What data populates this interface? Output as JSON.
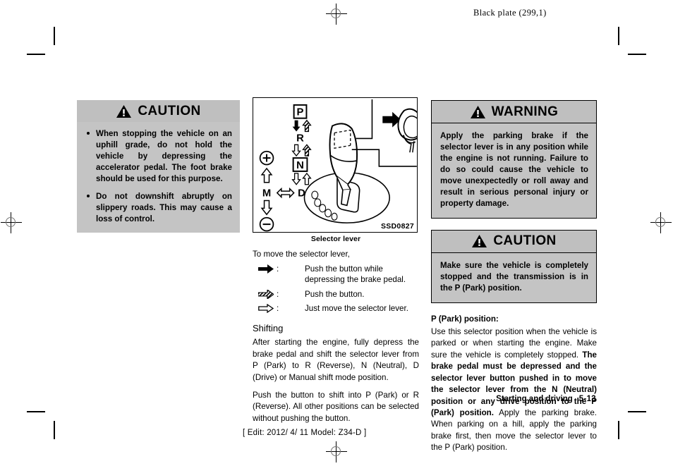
{
  "header": {
    "black_plate": "Black plate (299,1)"
  },
  "footer": {
    "section": "Starting and driving",
    "page": "5-13",
    "edit_line": "[ Edit: 2012/ 4/ 11   Model: Z34-D ]"
  },
  "left_column": {
    "caution": {
      "title": "CAUTION",
      "icon": "warning-triangle-icon",
      "bullets": [
        "When stopping the vehicle on an uphill grade, do not hold the vehicle by depressing the accelerator pedal. The foot brake should be used for this purpose.",
        "Do not downshift abruptly on slippery roads. This may cause a loss of control."
      ]
    }
  },
  "middle_column": {
    "figure": {
      "code": "SSD0827",
      "caption": "Selector lever",
      "gear_labels": {
        "park": "P",
        "reverse": "R",
        "neutral": "N",
        "drive": "D",
        "manual": "M",
        "upshift": "+",
        "downshift": "−"
      }
    },
    "intro": "To move the selector lever,",
    "legend": [
      {
        "icon": "solid-black-arrow-icon",
        "colon": ":",
        "text": "Push the button while depressing the brake pedal."
      },
      {
        "icon": "hatched-arrow-icon",
        "colon": ":",
        "text": "Push the button."
      },
      {
        "icon": "outline-arrow-icon",
        "colon": ":",
        "text": "Just move the selector lever."
      }
    ],
    "shifting": {
      "heading": "Shifting",
      "paragraphs": [
        "After starting the engine, fully depress the brake pedal and shift the selector lever from P (Park) to R (Reverse), N (Neutral), D (Drive) or Manual shift mode position.",
        "Push the button to shift into P (Park) or R (Reverse). All other positions can be selected without pushing the button."
      ]
    }
  },
  "right_column": {
    "warning": {
      "title": "WARNING",
      "icon": "warning-triangle-icon",
      "text": "Apply the parking brake if the selector lever is in any position while the engine is not running. Failure to do so could cause the vehicle to move unexpectedly or roll away and result in serious personal injury or property damage."
    },
    "caution": {
      "title": "CAUTION",
      "icon": "warning-triangle-icon",
      "text": "Make sure the vehicle is completely stopped and the transmission is in the P (Park) position."
    },
    "park_section": {
      "heading": "P (Park) position:",
      "text_part1": "Use this selector position when the vehicle is parked or when starting the engine. Make sure the vehicle is completely stopped. ",
      "text_bold": "The brake pedal must be depressed and the selector lever button pushed in to move the selector lever from the N (Neutral) position or any drive position to the P (Park) position.",
      "text_part2": " Apply the parking brake. When parking on a hill, apply the parking brake first, then move the selector lever to the P (Park) position."
    }
  },
  "colors": {
    "alert_header_gray": "#bfbfbf",
    "alert_body_gray": "#c4c4c4",
    "ink": "#000000",
    "page_background": "#ffffff"
  }
}
